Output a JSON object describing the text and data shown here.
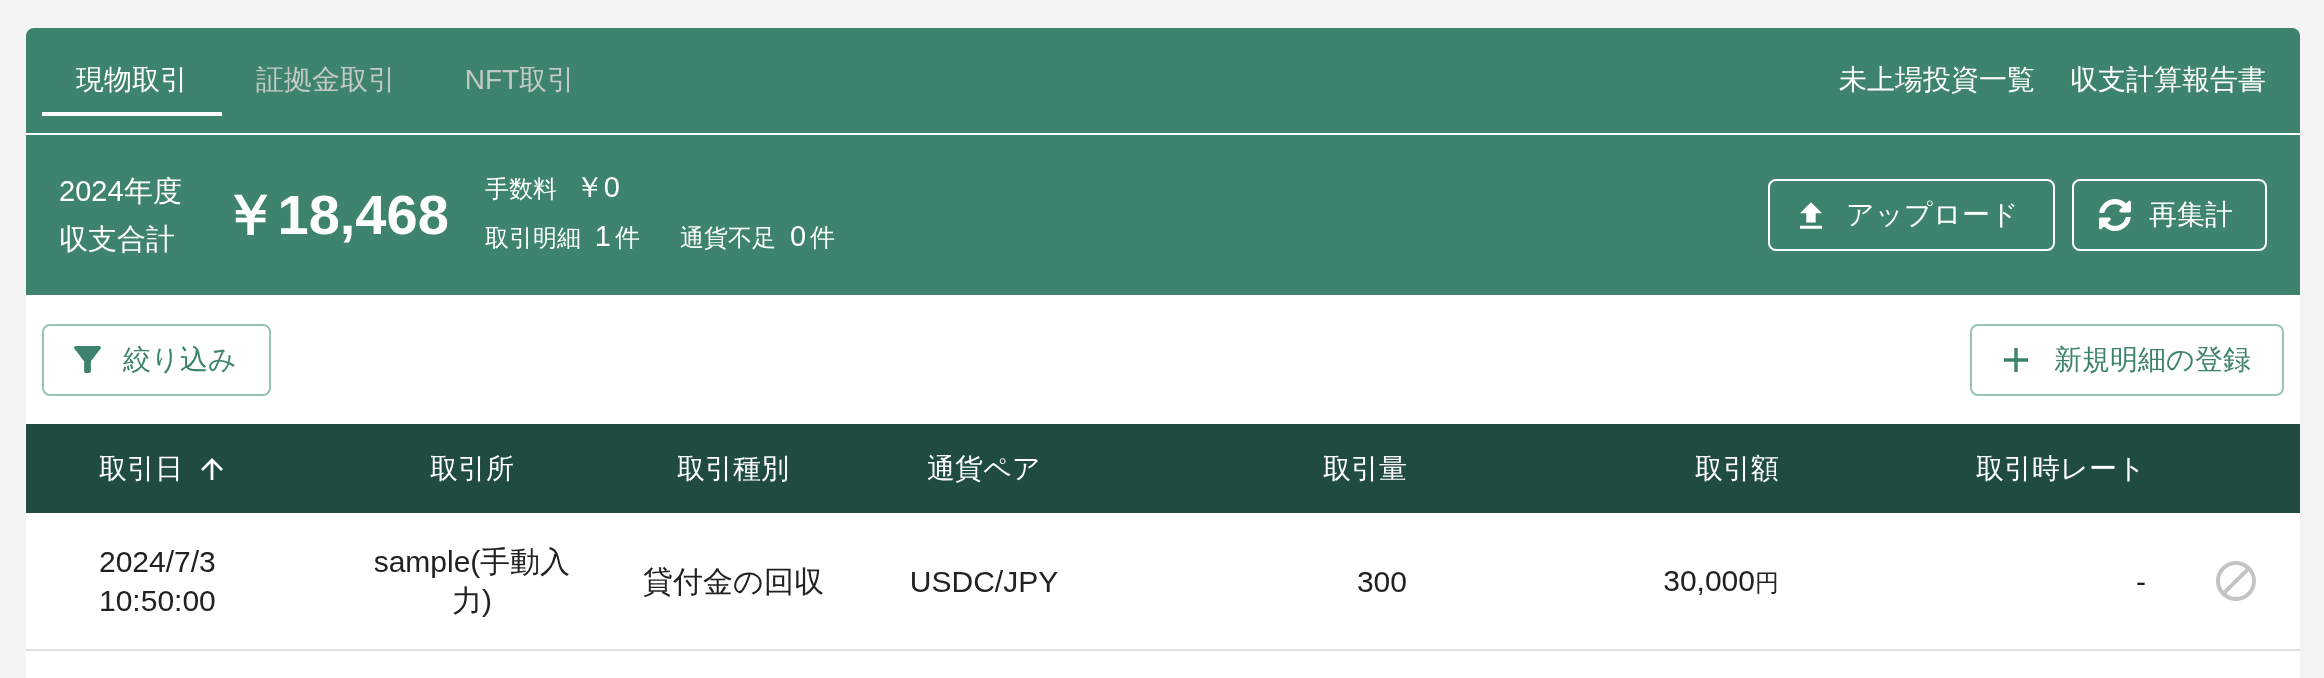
{
  "tabs": [
    {
      "label": "現物取引",
      "selected": true
    },
    {
      "label": "証拠金取引",
      "selected": false
    },
    {
      "label": "NFT取引",
      "selected": false
    }
  ],
  "header_links": [
    "未上場投資一覧",
    "収支計算報告書"
  ],
  "summary": {
    "year": "2024年度",
    "label": "収支合計",
    "total": "￥18,468",
    "fee_label": "手数料",
    "fee": "￥0",
    "detail_label": "取引明細",
    "detail_count": "1",
    "detail_unit": "件",
    "shortage_label": "通貨不足",
    "shortage_count": "0",
    "shortage_unit": "件"
  },
  "summary_buttons": [
    {
      "kind": "upload",
      "label": "アップロード"
    },
    {
      "kind": "refresh",
      "label": "再集計"
    }
  ],
  "toolbar": {
    "filter_button": "絞り込み",
    "add_button": "新規明細の登録"
  },
  "table": {
    "columns": [
      {
        "label": "取引日",
        "sorted": true
      },
      {
        "label": "取引所"
      },
      {
        "label": "取引種別"
      },
      {
        "label": "通貨ペア"
      },
      {
        "label": "取引量"
      },
      {
        "label": "取引額"
      },
      {
        "label": "取引時レート"
      }
    ],
    "rows": [
      {
        "date": "2024/7/3 10:50:00",
        "exchange": "sample(手動入力)",
        "type": "貸付金の回収",
        "pair": "USDC/JPY",
        "quantity": "300",
        "amount": "30,000",
        "amount_unit": "円",
        "rate": "-"
      }
    ]
  }
}
